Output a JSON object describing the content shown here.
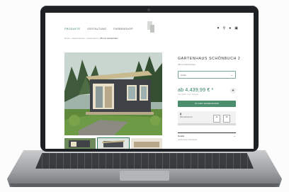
{
  "nav": {
    "items": [
      {
        "label": "PRODUKTE",
        "active": true
      },
      {
        "label": "GESTALTUNG",
        "active": false
      },
      {
        "label": "FARBENSHOP",
        "active": false
      }
    ],
    "icons": [
      "heart-icon",
      "search-icon",
      "user-icon",
      "cart-icon"
    ]
  },
  "breadcrumb": {
    "path": "Home › Gartenhäuser › Gartenhaus ›",
    "current": "28 mm Gartenhaus"
  },
  "product": {
    "title": "GARTENHAUS SCHÖNBUCH 2",
    "subtitle": "28mm Gartenhaus",
    "select_value": "Größe",
    "price": "ab 4.439,99 € *",
    "price_note": "inkl. MwSt. zzgl. Versand",
    "cart_button": "IN DEN WARENKORB",
    "delivery_label": "Wunschtermin",
    "delivery_from": "11",
    "delivery_to": "16",
    "details_heading": "Details",
    "details_sub": "Gartenhaus Schönbuch"
  },
  "colors": {
    "accent": "#2f7a5b",
    "button": "#4b8e6e"
  }
}
